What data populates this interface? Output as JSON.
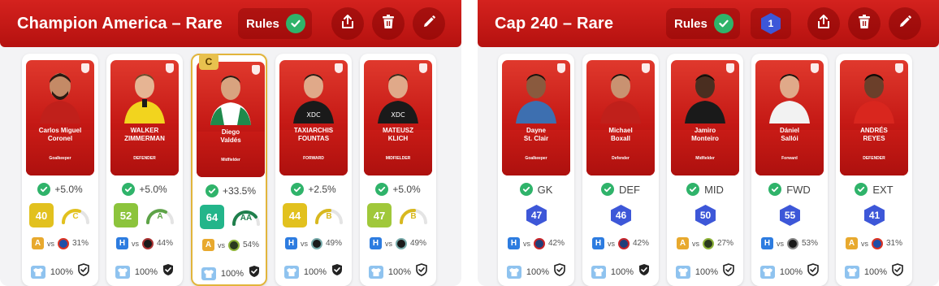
{
  "colors": {
    "header_red": "#c8191a",
    "check_green": "#2fb36a",
    "cap_blue": "#3d57d8",
    "home_blue": "#2d7ce0",
    "away_yellow": "#e8a92e"
  },
  "left_panel": {
    "title": "Champion America – Rare",
    "rules_label": "Rules",
    "icons": [
      "share-icon",
      "trash-icon",
      "pencil-icon"
    ],
    "cards": [
      {
        "name": "Carlos Miguel\nCoronel",
        "position": "Goalkeeper",
        "bonus": "+5.0%",
        "score": "40",
        "score_color": "#e2c11e",
        "grade": "C",
        "grade_color": "#e2c11e",
        "grade_level": 0.55,
        "venue": "A",
        "venue_color": "#e8a92e",
        "vs": "vs",
        "opponent_logo_color": "#1e4fa8",
        "pct": "31%",
        "footer_pct": "100%",
        "captain": false,
        "art": "#c51915"
      },
      {
        "name": "WALKER\nZIMMERMAN",
        "position": "DEFENDER",
        "bonus": "+5.0%",
        "score": "52",
        "score_color": "#8cc43c",
        "grade": "A",
        "grade_color": "#5da347",
        "grade_level": 0.6,
        "venue": "H",
        "venue_color": "#2d7ce0",
        "vs": "vs",
        "opponent_logo_color": "#1a1a1a",
        "pct": "44%",
        "footer_pct": "100%",
        "captain": false,
        "art": "#c51915"
      },
      {
        "name": "Diego\nValdés",
        "position": "Midfielder",
        "bonus": "+33.5%",
        "score": "64",
        "score_color": "#23b58a",
        "grade": "AA",
        "grade_color": "#1f7f4c",
        "grade_level": 0.8,
        "venue": "A",
        "venue_color": "#e8a92e",
        "vs": "vs",
        "opponent_logo_color": "#2b3a1f",
        "pct": "54%",
        "footer_pct": "100%",
        "captain": true,
        "captain_label": "C",
        "art": "#c51915"
      },
      {
        "name": "TAXIARCHIS\nFOUNTAS",
        "position": "FORWARD",
        "bonus": "+2.5%",
        "score": "44",
        "score_color": "#e2c11e",
        "grade": "B",
        "grade_color": "#d8b81f",
        "grade_level": 0.5,
        "venue": "H",
        "venue_color": "#2d7ce0",
        "vs": "vs",
        "opponent_logo_color": "#1a1a1a",
        "pct": "49%",
        "footer_pct": "100%",
        "captain": false,
        "art": "#c51915"
      },
      {
        "name": "MATEUSZ\nKLICH",
        "position": "MIDFIELDER",
        "bonus": "+5.0%",
        "score": "47",
        "score_color": "#a0c83a",
        "grade": "B",
        "grade_color": "#d8b81f",
        "grade_level": 0.5,
        "venue": "H",
        "venue_color": "#2d7ce0",
        "vs": "vs",
        "opponent_logo_color": "#1a1a1a",
        "pct": "49%",
        "footer_pct": "100%",
        "captain": false,
        "art": "#c51915"
      }
    ]
  },
  "right_panel": {
    "title": "Cap 240 – Rare",
    "rules_label": "Rules",
    "badge_count": "1",
    "icons": [
      "share-icon",
      "trash-icon",
      "pencil-icon"
    ],
    "cards": [
      {
        "name": "Dayne\nSt. Clair",
        "position": "Goalkeeper",
        "slot": "GK",
        "cap_score": "47",
        "venue": "H",
        "venue_color": "#2d7ce0",
        "vs": "vs",
        "opponent_logo_color": "#c8242a",
        "pct": "42%",
        "footer_pct": "100%"
      },
      {
        "name": "Michael\nBoxall",
        "position": "Defender",
        "slot": "DEF",
        "cap_score": "46",
        "venue": "H",
        "venue_color": "#2d7ce0",
        "vs": "vs",
        "opponent_logo_color": "#c8242a",
        "pct": "42%",
        "footer_pct": "100%"
      },
      {
        "name": "Jamiro\nMonteiro",
        "position": "Midfielder",
        "slot": "MID",
        "cap_score": "50",
        "venue": "A",
        "venue_color": "#e8a92e",
        "vs": "vs",
        "opponent_logo_color": "#2b3a1f",
        "pct": "27%",
        "footer_pct": "100%"
      },
      {
        "name": "Dániel\nSallói",
        "position": "Forward",
        "slot": "FWD",
        "cap_score": "55",
        "venue": "H",
        "venue_color": "#2d7ce0",
        "vs": "vs",
        "opponent_logo_color": "#1a1a1a",
        "pct": "53%",
        "footer_pct": "100%"
      },
      {
        "name": "ANDRÉS\nREYES",
        "position": "DEFENDER",
        "slot": "EXT",
        "cap_score": "41",
        "venue": "A",
        "venue_color": "#e8a92e",
        "vs": "vs",
        "opponent_logo_color": "#1e4fa8",
        "pct": "31%",
        "footer_pct": "100%"
      }
    ]
  }
}
